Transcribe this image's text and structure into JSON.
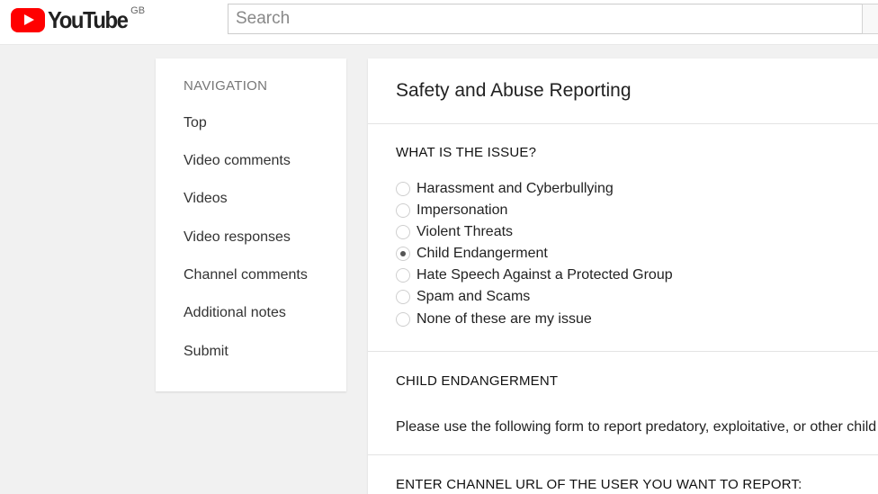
{
  "header": {
    "logo_text": "YouTube",
    "region": "GB",
    "search_placeholder": "Search",
    "search_value": ""
  },
  "sidebar": {
    "heading": "NAVIGATION",
    "items": [
      {
        "label": "Top"
      },
      {
        "label": "Video comments"
      },
      {
        "label": "Videos"
      },
      {
        "label": "Video responses"
      },
      {
        "label": "Channel comments"
      },
      {
        "label": "Additional notes"
      },
      {
        "label": "Submit"
      }
    ]
  },
  "main": {
    "title": "Safety and Abuse Reporting",
    "issue_heading": "WHAT IS THE ISSUE?",
    "options": [
      {
        "label": "Harassment and Cyberbullying",
        "checked": false
      },
      {
        "label": "Impersonation",
        "checked": false
      },
      {
        "label": "Violent Threats",
        "checked": false
      },
      {
        "label": "Child Endangerment",
        "checked": true
      },
      {
        "label": "Hate Speech Against a Protected Group",
        "checked": false
      },
      {
        "label": "Spam and Scams",
        "checked": false
      },
      {
        "label": "None of these are my issue",
        "checked": false
      }
    ],
    "child_heading": "CHILD ENDANGERMENT",
    "child_description": "Please use the following form to report predatory, exploitative, or other child e",
    "channel_url_heading": "ENTER CHANNEL URL OF THE USER YOU WANT TO REPORT:"
  },
  "colors": {
    "brand_red": "#ff0000",
    "page_background": "#f1f1f1"
  }
}
